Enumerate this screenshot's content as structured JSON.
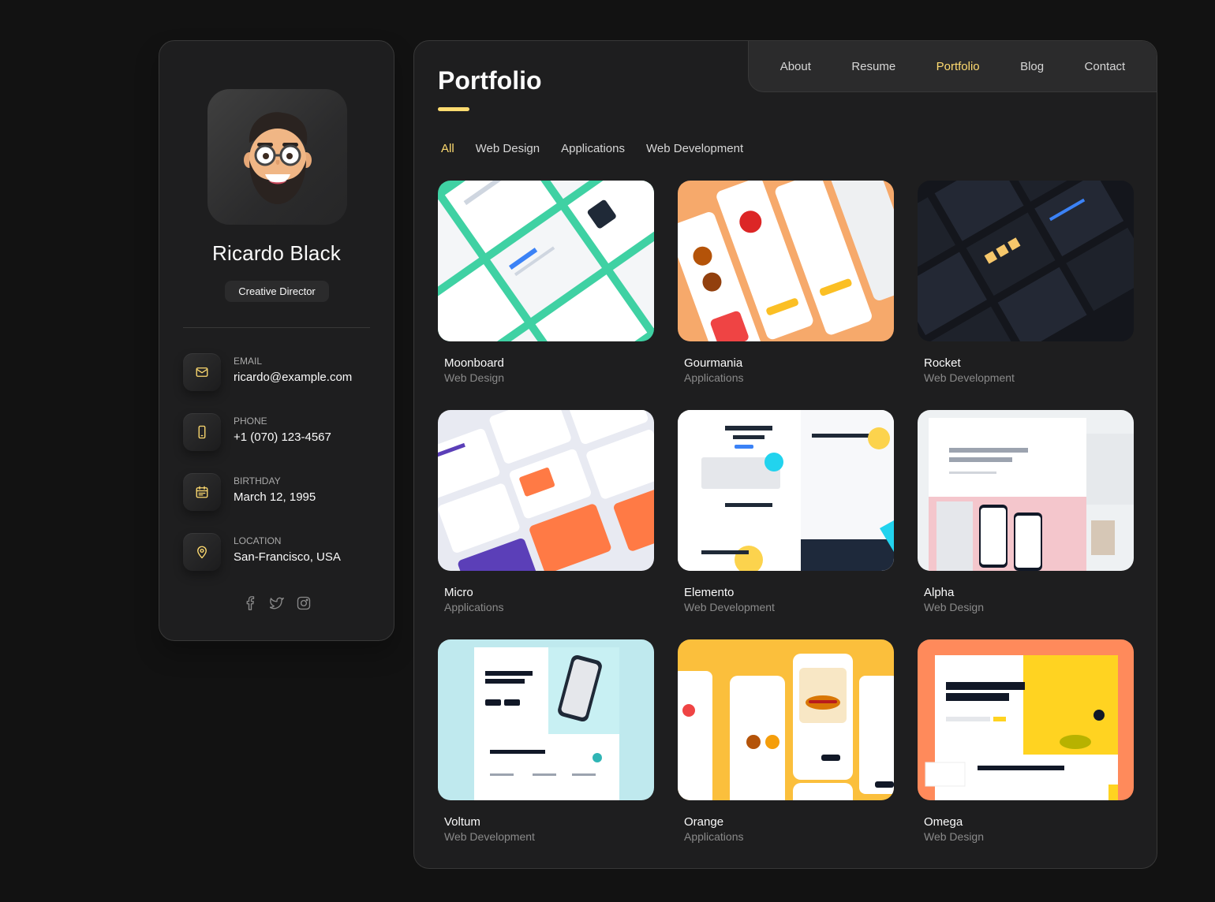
{
  "profile": {
    "name": "Ricardo Black",
    "title": "Creative Director"
  },
  "contacts": [
    {
      "label": "Email",
      "value": "ricardo@example.com",
      "icon": "mail-icon"
    },
    {
      "label": "Phone",
      "value": "+1 (070) 123-4567",
      "icon": "phone-icon"
    },
    {
      "label": "Birthday",
      "value": "March 12, 1995",
      "icon": "calendar-icon"
    },
    {
      "label": "Location",
      "value": "San-Francisco, USA",
      "icon": "location-pin-icon"
    }
  ],
  "socials": [
    "facebook-icon",
    "twitter-icon",
    "instagram-icon"
  ],
  "nav": [
    {
      "label": "About"
    },
    {
      "label": "Resume"
    },
    {
      "label": "Portfolio",
      "active": true
    },
    {
      "label": "Blog"
    },
    {
      "label": "Contact"
    }
  ],
  "page": {
    "title": "Portfolio"
  },
  "filters": [
    {
      "label": "All",
      "active": true
    },
    {
      "label": "Web Design"
    },
    {
      "label": "Applications"
    },
    {
      "label": "Web Development"
    }
  ],
  "projects": [
    {
      "title": "Moonboard",
      "category": "Web Design"
    },
    {
      "title": "Gourmania",
      "category": "Applications"
    },
    {
      "title": "Rocket",
      "category": "Web Development"
    },
    {
      "title": "Micro",
      "category": "Applications"
    },
    {
      "title": "Elemento",
      "category": "Web Development"
    },
    {
      "title": "Alpha",
      "category": "Web Design"
    },
    {
      "title": "Voltum",
      "category": "Web Development"
    },
    {
      "title": "Orange",
      "category": "Applications"
    },
    {
      "title": "Omega",
      "category": "Web Design"
    }
  ],
  "colors": {
    "accent": "#ffdb70",
    "background": "#121212",
    "card": "#1e1e1f",
    "border": "#383838"
  }
}
